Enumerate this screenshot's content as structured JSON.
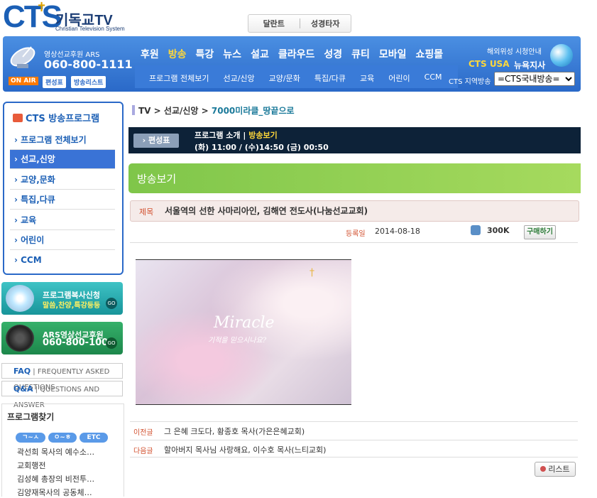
{
  "header": {
    "logo_mark": "CTS",
    "logo_cross": "✝",
    "logo_kr": "기독교TV",
    "logo_en": "Christian Television System",
    "top_links": [
      "달란트",
      "성경타자"
    ],
    "ars_label": "영상선교후원 ARS",
    "ars_number": "060-800-1111",
    "onair": "ON AIR",
    "schedule_btn": "편성표",
    "broadcast_list_btn": "방송리스트",
    "main_nav": [
      "후원",
      "방송",
      "특강",
      "뉴스",
      "설교",
      "클라우드",
      "성경",
      "큐티",
      "모바일",
      "쇼핑몰"
    ],
    "main_nav_active": 1,
    "sub_nav": [
      "프로그램 전체보기",
      "선교/신앙",
      "교양/문화",
      "특집/다큐",
      "교육",
      "어린이",
      "CCM"
    ],
    "overseas": "해외위성 시청안내",
    "cts_usa": "CTS USA",
    "ny_branch": "뉴욕지사",
    "local_label": "CTS 지역방송",
    "local_select": "=CTS국내방송="
  },
  "sidebar": {
    "title": "CTS 방송프로그램",
    "items": [
      "프로그램 전체보기",
      "선교,신앙",
      "교양,문화",
      "특집,다큐",
      "교육",
      "어린이",
      "CCM"
    ],
    "active_index": 1,
    "banner1": {
      "title": "프로그램복사신청",
      "sub": "말씀,찬양,특강등등",
      "go": "GO"
    },
    "banner2": {
      "title": "ARS영상선교후원",
      "sub": "060-800-1008",
      "go": "GO"
    },
    "faq": {
      "label": "FAQ",
      "desc": "FREQUENTLY ASKED QUESTIONS"
    },
    "qna": {
      "label": "Q&A",
      "desc": "QUESTIONS AND ANSWER"
    },
    "find_title": "프로그램찾기",
    "pills": [
      "ㄱ~ㅅ",
      "ㅇ~ㅎ",
      "ETC"
    ],
    "find_items": [
      "곽선희 목사의 예수소…",
      "교회행전",
      "김성혜 총장의 비전투…",
      "김양재목사의 공동체…"
    ]
  },
  "main": {
    "breadcrumb": [
      "TV",
      "선교/신앙",
      "7000미라클_땅끝으로"
    ],
    "schedule_btn": "편성표",
    "tab_intro": "프로그램 소개",
    "tab_sep": "|",
    "tab_watch": "방송보기",
    "times": "(화) 11:00 / (수)14:50 (금) 00:50",
    "section_title": "방송보기",
    "title_label": "제목",
    "title_value": "서울역의 선한 사마리아인, 김해연 전도사(나눔선교교회)",
    "date_label": "등록일",
    "date_value": "2014-08-18",
    "views": "300K",
    "subscribe": "구매하기",
    "video_title": "Miracle",
    "video_sub": "기적을 믿으시나요?",
    "prev_label": "이전글",
    "prev_value": "그 은혜 크도다, 황종호 목사(가은은혜교회)",
    "next_label": "다음글",
    "next_value": "할아버지 목사님 사랑해요, 이수호 목사(느티교회)",
    "list_btn": "리스트"
  }
}
